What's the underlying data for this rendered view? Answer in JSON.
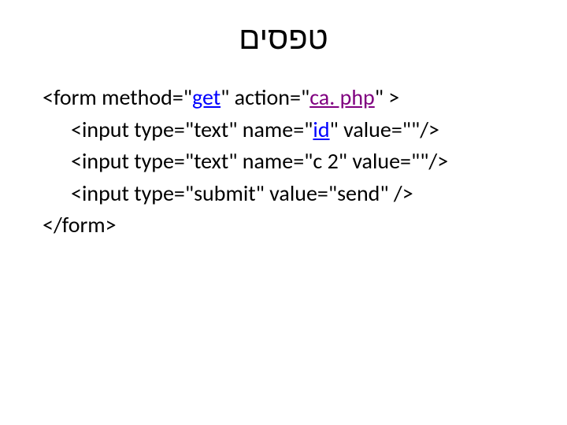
{
  "title": "טפסים",
  "lines": {
    "l0_a": "<form method=\"",
    "l0_b": "get",
    "l0_c": "\" action=\"",
    "l0_d": "ca. php",
    "l0_e": "\" >",
    "l1_a": "<input type=\"text\" name=\"",
    "l1_b": "id",
    "l1_c": "\" value=\"\"/>",
    "l2": "<input type=\"text\" name=\"c 2\" value=\"\"/>",
    "l3": "<input type=\"submit\" value=\"send\" />",
    "l4": "</form>"
  }
}
